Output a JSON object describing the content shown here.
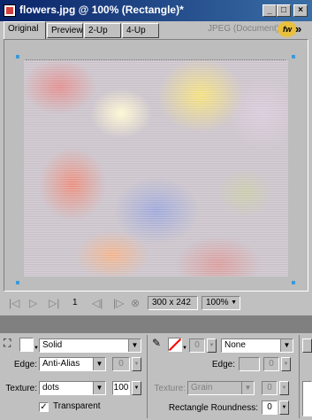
{
  "window": {
    "title": "flowers.jpg @ 100% (Rectangle)*",
    "buttons": {
      "minimize": "_",
      "maximize": "□",
      "close": "×"
    }
  },
  "tabs": [
    {
      "label": "Original",
      "active": true
    },
    {
      "label": "Preview",
      "active": false
    },
    {
      "label": "2-Up",
      "active": false
    },
    {
      "label": "4-Up",
      "active": false
    }
  ],
  "format_label": "JPEG (Document)",
  "status": {
    "frame_number": "1",
    "image_size": "300 x 242",
    "zoom": "100%"
  },
  "properties": {
    "fill": {
      "type": "Solid",
      "edge_label": "Edge:",
      "edge_value": "Anti-Alias",
      "edge_amount": "0",
      "texture_label": "Texture:",
      "texture_value": "dots",
      "texture_amount": "100",
      "transparent_label": "Transparent",
      "transparent_checked": true
    },
    "stroke": {
      "size": "0",
      "type": "None",
      "edge_label": "Edge:",
      "edge_amount": "0",
      "texture_label": "Texture:",
      "texture_value": "Grain",
      "texture_amount": "0",
      "roundness_label": "Rectangle Roundness:",
      "roundness_value": "0"
    }
  },
  "colors": {
    "titlebar_start": "#0a246a",
    "titlebar_end": "#3a6ea5",
    "handle": "#3a9ad9",
    "stroke_swatch_slash": "#ff0000"
  }
}
